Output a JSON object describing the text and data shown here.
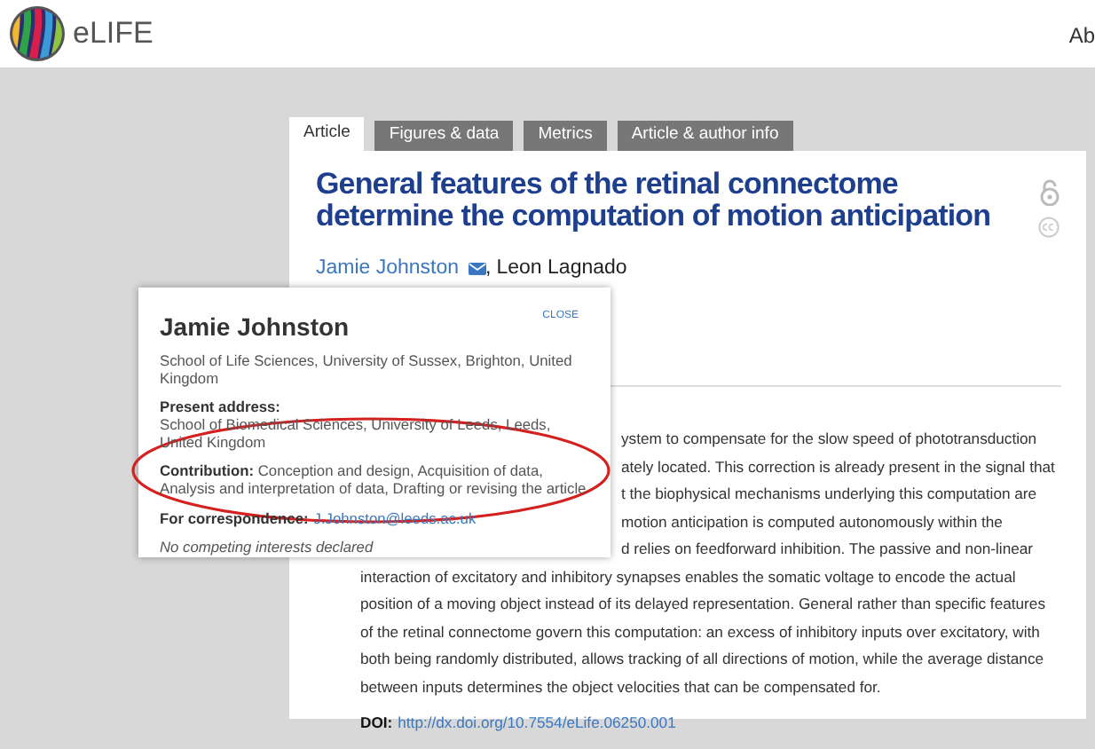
{
  "header": {
    "logo_text": "eLIFE",
    "nav_text": "Ab"
  },
  "tabs": [
    {
      "label": "Article",
      "selected": true
    },
    {
      "label": "Figures & data",
      "selected": false
    },
    {
      "label": "Metrics",
      "selected": false
    },
    {
      "label": "Article & author info",
      "selected": false
    }
  ],
  "article": {
    "title": "General features of the retinal connectome determine the computation of motion anticipation",
    "author_separator": ",",
    "authors": [
      {
        "name": "Jamie Johnston",
        "corresponding": true
      },
      {
        "name": "Leon Lagnado",
        "corresponding": false
      }
    ],
    "abstract_lines": [
      {
        "text": "ystem to compensate for the slow speed of phototransduction",
        "covered": true
      },
      {
        "text": "ately located. This correction is already present in the signal that",
        "covered": true
      },
      {
        "text": "t the biophysical mechanisms underlying this computation are",
        "covered": true
      },
      {
        "text": "motion anticipation is computed autonomously within the",
        "covered": true
      },
      {
        "text": "d relies on feedforward inhibition. The passive and non-linear",
        "covered": true
      },
      {
        "text": "interaction of excitatory and inhibitory synapses enables the somatic voltage to encode the actual",
        "covered": false
      },
      {
        "text": "position of a moving object instead of its delayed representation. General rather than specific features",
        "covered": false
      },
      {
        "text": "of the retinal connectome govern this computation: an excess of inhibitory inputs over excitatory, with",
        "covered": false
      },
      {
        "text": "both being randomly distributed, allows tracking of all directions of motion, while the average distance",
        "covered": false
      },
      {
        "text": "between inputs determines the object velocities that can be compensated for.",
        "covered": false
      }
    ],
    "doi": {
      "label": "DOI:",
      "link": "http://dx.doi.org/10.7554/eLife.06250.001"
    }
  },
  "author_popup": {
    "name": "Jamie Johnston",
    "close": "CLOSE",
    "affiliation": "School of Life Sciences, University of Sussex, Brighton, United Kingdom",
    "present_address_label": "Present address:",
    "present_address": "School of Biomedical Sciences, University of Leeds, Leeds, United Kingdom",
    "contribution_label": "Contribution:",
    "contribution": "Conception and design, Acquisition of data, Analysis and interpretation of data, Drafting or revising the article",
    "correspondence_label": "For correspondence:",
    "email": "J.Johnston@leeds.ac.uk",
    "competing": "No competing interests declared"
  }
}
